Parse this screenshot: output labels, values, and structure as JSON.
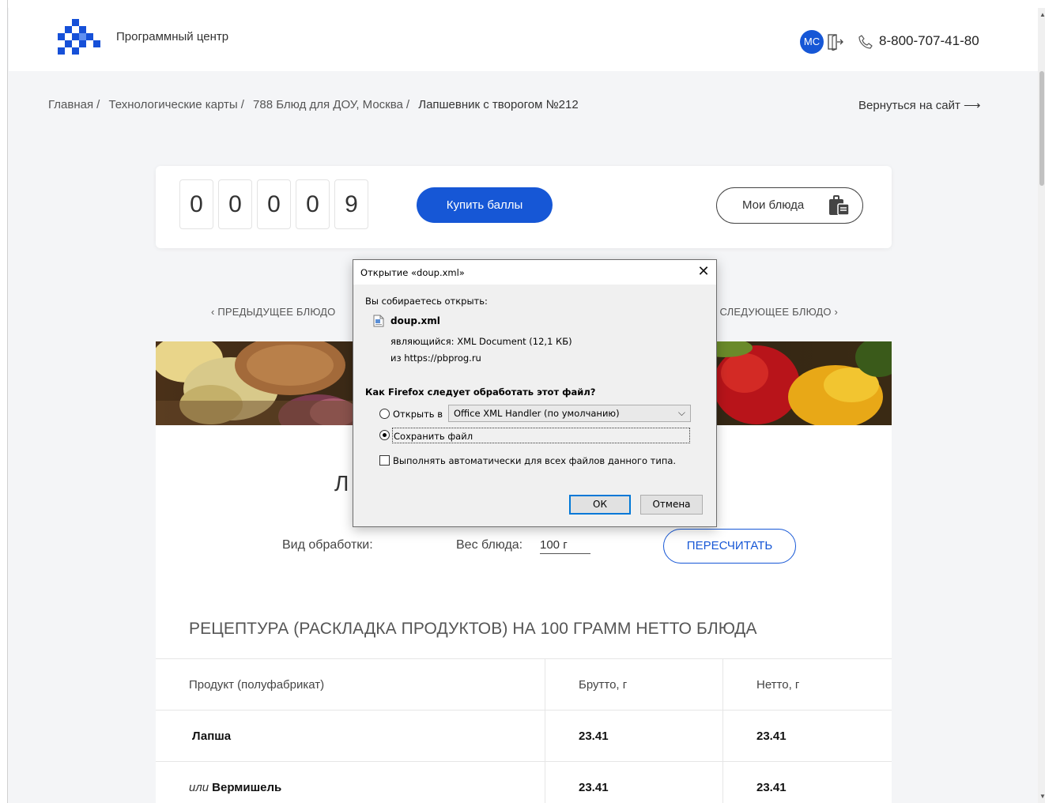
{
  "header": {
    "brand": "Программный центр",
    "avatar_initials": "МС",
    "phone": "8-800-707-41-80"
  },
  "breadcrumb": [
    "Главная",
    "Технологические карты",
    "788 Блюд для ДОУ, Москва",
    "Лапшевник с творогом №212"
  ],
  "back_link": "Вернуться на сайт ⟶",
  "points": {
    "digits": [
      "0",
      "0",
      "0",
      "0",
      "9"
    ],
    "buy_label": "Купить баллы",
    "my_dishes_label": "Мои блюда"
  },
  "nav": {
    "prev_label": "‹  ПРЕДЫДУЩЕЕ БЛЮДО",
    "next_label": "СЛЕДУЮЩЕЕ БЛЮДО  ›"
  },
  "dish": {
    "title_partial": "Л",
    "processing_label": "Вид обработки:",
    "weight_label": "Вес блюда:",
    "weight_value": "100 г",
    "recalc_label": "ПЕРЕСЧИТАТЬ",
    "recipe_heading": "РЕЦЕПТУРА (РАСКЛАДКА ПРОДУКТОВ) НА 100 ГРАММ НЕТТО БЛЮДА"
  },
  "table": {
    "headers": [
      "Продукт (полуфабрикат)",
      "Брутто, г",
      "Нетто, г"
    ],
    "rows": [
      {
        "alt": "",
        "product": "Лапша",
        "gross": "23.41",
        "net": "23.41"
      },
      {
        "alt": "или",
        "product": "Вермишель",
        "gross": "23.41",
        "net": "23.41"
      }
    ]
  },
  "dialog": {
    "title": "Открытие «doup.xml»",
    "about": "Вы собираетесь открыть:",
    "filename": "doup.xml",
    "type_line": "являющийся:  XML Document (12,1 КБ)",
    "from_line": "из  https://pbprog.ru",
    "question": "Как Firefox следует обработать этот файл?",
    "open_in_label": "Открыть в",
    "open_in_value": "Office XML Handler (по умолчанию)",
    "save_label": "Сохранить файл",
    "auto_label": "Выполнять автоматически для всех файлов данного типа.",
    "ok_label": "ОК",
    "cancel_label": "Отмена",
    "selected_option": "save"
  },
  "colors": {
    "accent": "#1657d6",
    "page_bg": "#f4f5f7"
  }
}
